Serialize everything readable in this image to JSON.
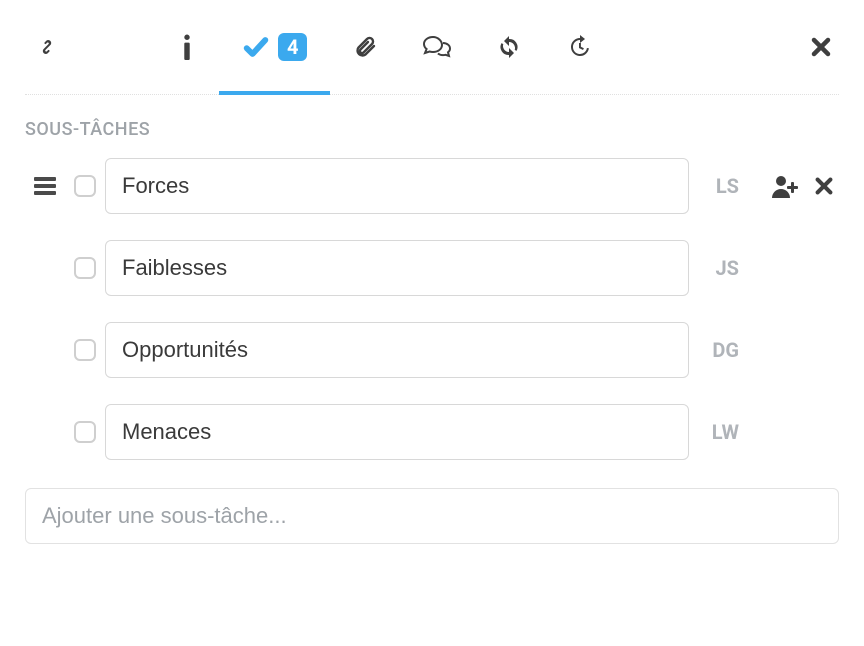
{
  "colors": {
    "accent": "#3ba9ee",
    "iconDark": "#3f3f3f",
    "iconMuted": "#9ea3a8"
  },
  "tabs": {
    "subtask_count": "4"
  },
  "section": {
    "title": "SOUS-TÂCHES"
  },
  "subtasks": [
    {
      "label": "Forces",
      "assignee": "LS",
      "show_drag": true,
      "show_actions": true
    },
    {
      "label": "Faiblesses",
      "assignee": "JS",
      "show_drag": false,
      "show_actions": false
    },
    {
      "label": "Opportunités",
      "assignee": "DG",
      "show_drag": false,
      "show_actions": false
    },
    {
      "label": "Menaces",
      "assignee": "LW",
      "show_drag": false,
      "show_actions": false
    }
  ],
  "add": {
    "placeholder": "Ajouter une sous-tâche..."
  }
}
